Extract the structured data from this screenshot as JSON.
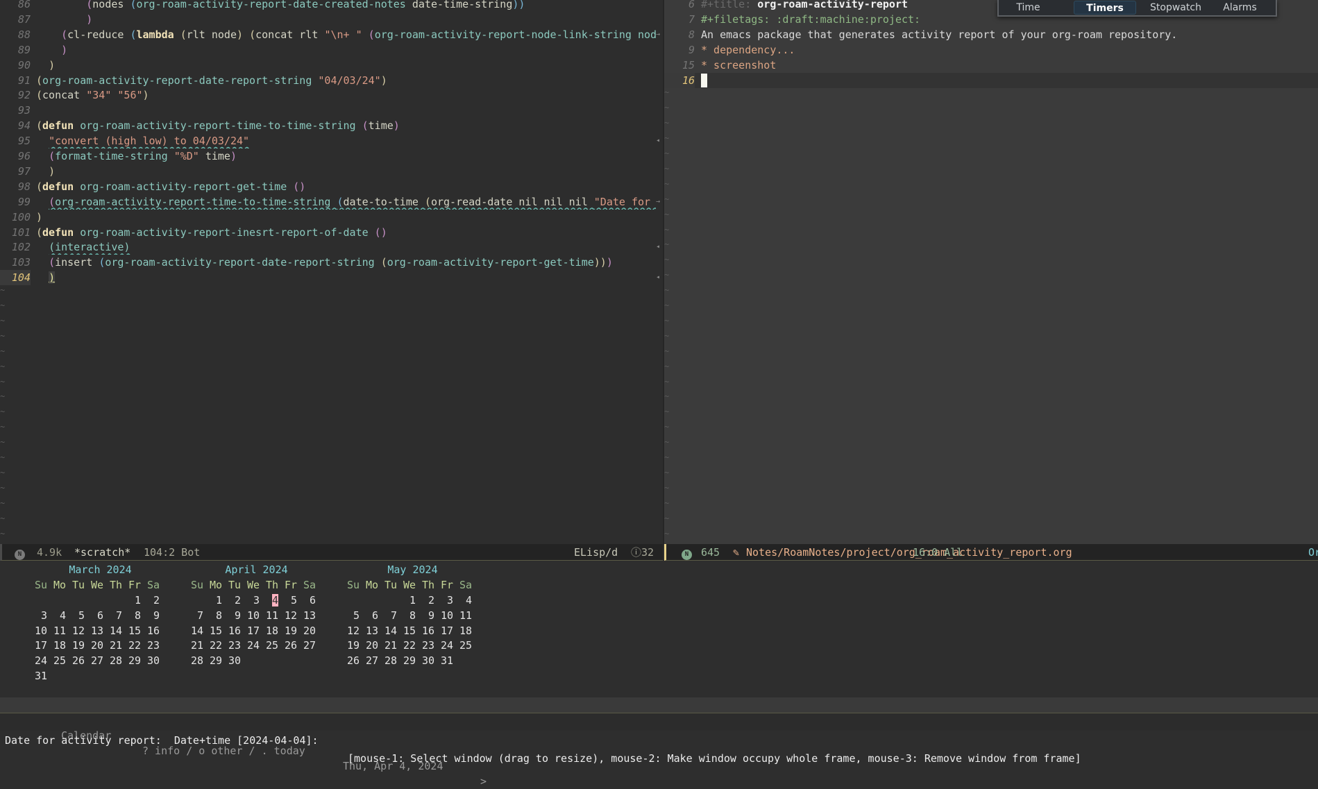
{
  "colors": {
    "accent_pink": "#ffb3c1",
    "calendar_title": "#7fd0d8",
    "cursor_line_number": "#e2c47a"
  },
  "empty_line_marker": "~",
  "left_buffer": {
    "lines": [
      {
        "n": "86",
        "segs": [
          [
            "        ",
            "txt"
          ],
          [
            "(",
            "p2"
          ],
          [
            "nodes ",
            "txt"
          ],
          [
            "(",
            "p3"
          ],
          [
            "org-roam-activity-report-date-created-notes ",
            "fn"
          ],
          [
            "date-time-string",
            "txt"
          ],
          [
            "))",
            "p3"
          ]
        ]
      },
      {
        "n": "87",
        "segs": [
          [
            "        ",
            "txt"
          ],
          [
            ")",
            "p2"
          ]
        ]
      },
      {
        "n": "88",
        "segs": [
          [
            "    ",
            "txt"
          ],
          [
            "(",
            "p2"
          ],
          [
            "cl-reduce ",
            "txt"
          ],
          [
            "(",
            "p3"
          ],
          [
            "lambda ",
            "kw"
          ],
          [
            "(",
            "p1"
          ],
          [
            "rlt node",
            "txt"
          ],
          [
            ") ",
            "p1"
          ],
          [
            "(",
            "p1"
          ],
          [
            "concat rlt ",
            "txt"
          ],
          [
            "\"\\n+ \" ",
            "str"
          ],
          [
            "(",
            "p2"
          ],
          [
            "org-roam-activity-report-node-link-string node",
            "fn"
          ]
        ],
        "fringe": "→"
      },
      {
        "n": "89",
        "segs": [
          [
            "    ",
            "txt"
          ],
          [
            ")",
            "p2"
          ]
        ]
      },
      {
        "n": "90",
        "segs": [
          [
            "  ",
            "txt"
          ],
          [
            ")",
            "p1"
          ]
        ]
      },
      {
        "n": "91",
        "segs": [
          [
            "(",
            "p1"
          ],
          [
            "org-roam-activity-report-date-report-string ",
            "fn"
          ],
          [
            "\"04/03/24\"",
            "str"
          ],
          [
            ")",
            "p1"
          ]
        ]
      },
      {
        "n": "92",
        "segs": [
          [
            "(",
            "p1"
          ],
          [
            "concat ",
            "txt"
          ],
          [
            "\"34\" \"56\"",
            "str"
          ],
          [
            ")",
            "p1"
          ]
        ]
      },
      {
        "n": "93",
        "segs": []
      },
      {
        "n": "94",
        "segs": [
          [
            "(",
            "p1"
          ],
          [
            "defun ",
            "kw"
          ],
          [
            "org-roam-activity-report-time-to-time-string ",
            "fn"
          ],
          [
            "(",
            "p2"
          ],
          [
            "time",
            "txt"
          ],
          [
            ")",
            "p2"
          ]
        ]
      },
      {
        "n": "95",
        "segs": [
          [
            "  ",
            "txt"
          ],
          [
            "\"convert (high low) to 04/03/24\"",
            "str ul"
          ]
        ],
        "fringe": "◂"
      },
      {
        "n": "96",
        "segs": [
          [
            "  ",
            "txt"
          ],
          [
            "(",
            "p2"
          ],
          [
            "format-time-string ",
            "fn"
          ],
          [
            "\"%D\" ",
            "str"
          ],
          [
            "time",
            "txt"
          ],
          [
            ")",
            "p2"
          ]
        ]
      },
      {
        "n": "97",
        "segs": [
          [
            "  ",
            "txt"
          ],
          [
            ")",
            "p1"
          ]
        ]
      },
      {
        "n": "98",
        "segs": [
          [
            "(",
            "p1"
          ],
          [
            "defun ",
            "kw"
          ],
          [
            "org-roam-activity-report-get-time ",
            "fn"
          ],
          [
            "()",
            "p2"
          ]
        ]
      },
      {
        "n": "99",
        "segs": [
          [
            "  ",
            "txt"
          ],
          [
            "(",
            "p2 ul"
          ],
          [
            "org-roam-activity-report-time-to-time-string ",
            "fn ul"
          ],
          [
            "(",
            "p3 ul"
          ],
          [
            "date-to-time ",
            "txt ul"
          ],
          [
            "(",
            "p1 ul"
          ],
          [
            "org-read-date nil nil nil ",
            "txt ul"
          ],
          [
            "\"Date for activity report: \"",
            "str ul"
          ]
        ],
        "fringe": "→"
      },
      {
        "n": "100",
        "segs": [
          [
            ")",
            "p1"
          ]
        ]
      },
      {
        "n": "101",
        "segs": [
          [
            "(",
            "p1"
          ],
          [
            "defun ",
            "kw"
          ],
          [
            "org-roam-activity-report-inesrt-report-of-date ",
            "fn"
          ],
          [
            "()",
            "p2"
          ]
        ]
      },
      {
        "n": "102",
        "segs": [
          [
            "  ",
            "txt"
          ],
          [
            "(interactive)",
            "fn ul"
          ]
        ],
        "fringe": "◂"
      },
      {
        "n": "103",
        "segs": [
          [
            "  ",
            "txt"
          ],
          [
            "(",
            "p2"
          ],
          [
            "insert ",
            "txt"
          ],
          [
            "(",
            "p3"
          ],
          [
            "org-roam-activity-report-date-report-string ",
            "fn"
          ],
          [
            "(",
            "p1"
          ],
          [
            "org-roam-activity-report-get-time",
            "fn"
          ],
          [
            "))",
            "p1"
          ],
          [
            ")",
            "p2"
          ]
        ]
      },
      {
        "n": "104",
        "segs": [
          [
            "  ",
            "txt"
          ],
          [
            ")",
            "p1 cursor"
          ]
        ],
        "fringe": "◂",
        "current": true
      }
    ]
  },
  "right_buffer": {
    "lines": [
      {
        "n": "6",
        "segs": [
          [
            "#+title: ",
            "meta"
          ],
          [
            "org-roam-activity-report",
            "title"
          ]
        ]
      },
      {
        "n": "7",
        "segs": [
          [
            "#+filetags: :draft:machine:project:",
            "tags"
          ]
        ]
      },
      {
        "n": "8",
        "segs": [
          [
            "An emacs package that generates activity report of your org-roam repository.",
            "body"
          ]
        ]
      },
      {
        "n": "9",
        "segs": [
          [
            "* dependency...",
            "h1"
          ]
        ]
      },
      {
        "n": "15",
        "segs": [
          [
            "* screenshot",
            "h1"
          ]
        ]
      },
      {
        "n": "16",
        "segs": [],
        "current": true
      }
    ]
  },
  "modeline_left": {
    "icon": "nano-badge-icon",
    "size": "4.9k",
    "buffer": "*scratch*",
    "position": "104:2 Bot",
    "mode": "ELisp/d",
    "warnings": "32"
  },
  "modeline_right": {
    "icon": "nano-badge-icon",
    "size": "645",
    "file_icon": "file-edit-icon",
    "path": "Notes/RoamNotes/project/org_roam_activity_report.org",
    "position": "16:0 All",
    "mode": "Or"
  },
  "clock_popup": {
    "tabs": [
      "Time",
      "Timers",
      "Stopwatch",
      "Alarms"
    ],
    "active": "Timers"
  },
  "calendar": {
    "day_headers": [
      "Su",
      "Mo",
      "Tu",
      "We",
      "Th",
      "Fr",
      "Sa"
    ],
    "selected": {
      "month": 1,
      "day": "4"
    },
    "months": [
      {
        "title": "March 2024",
        "weeks": [
          [
            "",
            "",
            "",
            "",
            "",
            "1",
            "2"
          ],
          [
            "3",
            "4",
            "5",
            "6",
            "7",
            "8",
            "9"
          ],
          [
            "10",
            "11",
            "12",
            "13",
            "14",
            "15",
            "16"
          ],
          [
            "17",
            "18",
            "19",
            "20",
            "21",
            "22",
            "23"
          ],
          [
            "24",
            "25",
            "26",
            "27",
            "28",
            "29",
            "30"
          ],
          [
            "31",
            "",
            "",
            "",
            "",
            "",
            ""
          ]
        ]
      },
      {
        "title": "April 2024",
        "weeks": [
          [
            "",
            "1",
            "2",
            "3",
            "4",
            "5",
            "6"
          ],
          [
            "7",
            "8",
            "9",
            "10",
            "11",
            "12",
            "13"
          ],
          [
            "14",
            "15",
            "16",
            "17",
            "18",
            "19",
            "20"
          ],
          [
            "21",
            "22",
            "23",
            "24",
            "25",
            "26",
            "27"
          ],
          [
            "28",
            "29",
            "30",
            "",
            "",
            "",
            ""
          ]
        ]
      },
      {
        "title": "May 2024",
        "weeks": [
          [
            "",
            "",
            "",
            "1",
            "2",
            "3",
            "4"
          ],
          [
            "5",
            "6",
            "7",
            "8",
            "9",
            "10",
            "11"
          ],
          [
            "12",
            "13",
            "14",
            "15",
            "16",
            "17",
            "18"
          ],
          [
            "19",
            "20",
            "21",
            "22",
            "23",
            "24",
            "25"
          ],
          [
            "26",
            "27",
            "28",
            "29",
            "30",
            "31",
            ""
          ]
        ]
      }
    ],
    "footer": {
      "prev": "<",
      "name": "Calendar",
      "help": "? info / o other / . today",
      "date": "Thu, Apr 4, 2024",
      "next": ">"
    }
  },
  "echo": {
    "prompt": "Date for activity report:  Date+time [2024-04-04]:",
    "tooltip": "[mouse-1: Select window (drag to resize), mouse-2: Make window occupy whole frame, mouse-3: Remove window from frame]"
  }
}
